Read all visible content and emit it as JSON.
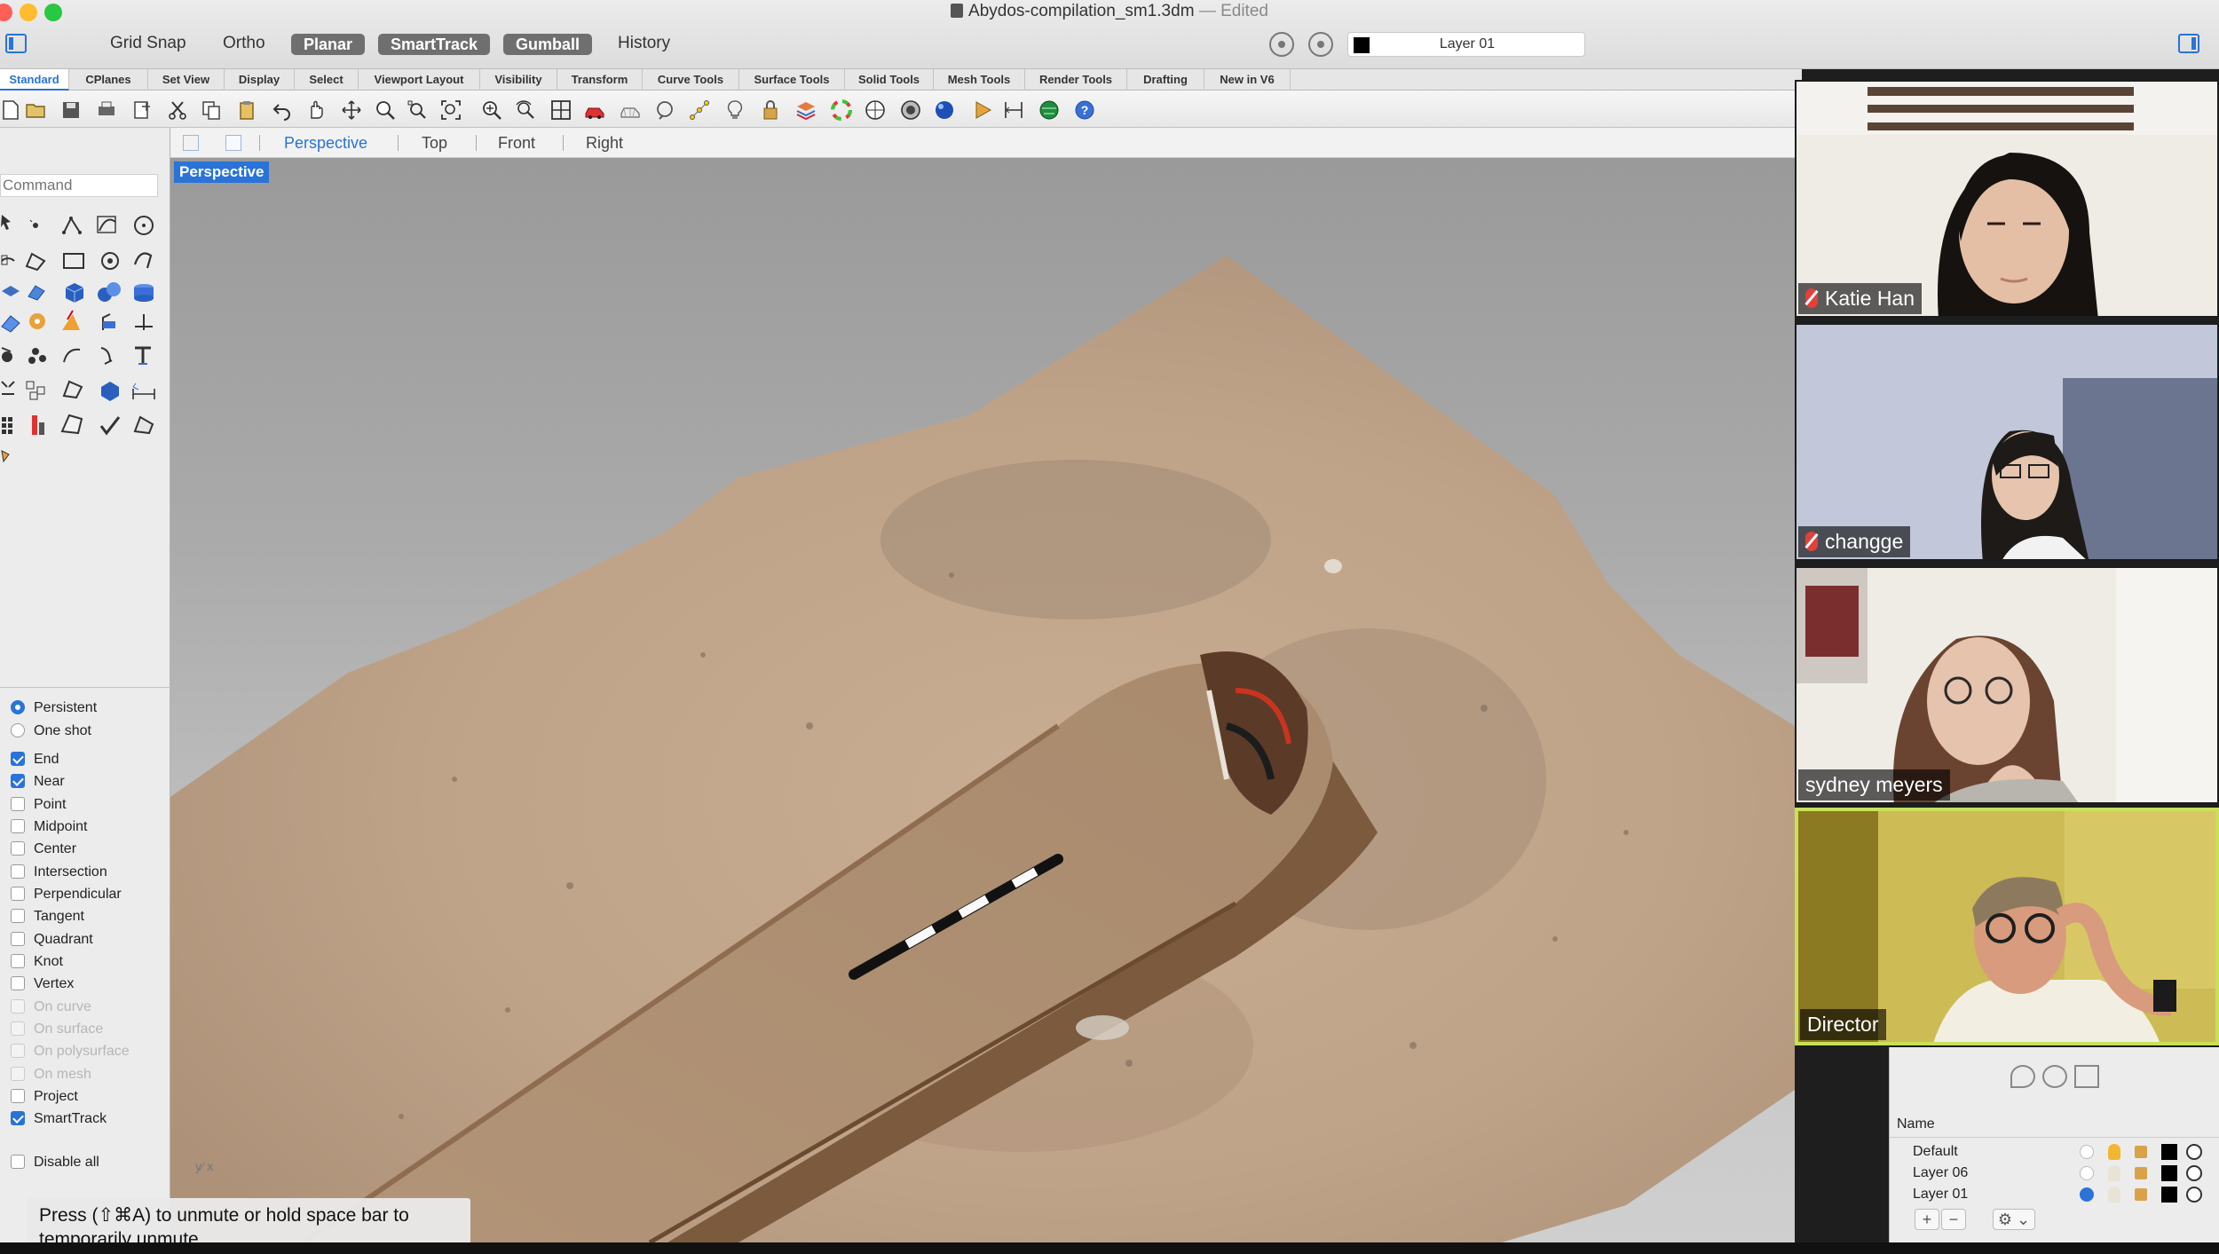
{
  "window": {
    "title": "Abydos-compilation_sm1.3dm",
    "status": "— Edited"
  },
  "toolbar_toggles": {
    "grid_snap": "Grid Snap",
    "ortho": "Ortho",
    "planar": "Planar",
    "smarttrack": "SmartTrack",
    "gumball": "Gumball",
    "history": "History"
  },
  "current_layer": "Layer 01",
  "tabs": [
    "Standard",
    "CPlanes",
    "Set View",
    "Display",
    "Select",
    "Viewport Layout",
    "Visibility",
    "Transform",
    "Curve Tools",
    "Surface Tools",
    "Solid Tools",
    "Mesh Tools",
    "Render Tools",
    "Drafting",
    "New in V6"
  ],
  "active_tab": "Standard",
  "command": {
    "placeholder": "Command"
  },
  "viewport_tabs": [
    "Perspective",
    "Top",
    "Front",
    "Right"
  ],
  "active_viewport": "Perspective",
  "viewport_label": "Perspective",
  "osnap": {
    "mode_options": [
      {
        "label": "Persistent",
        "selected": true
      },
      {
        "label": "One shot",
        "selected": false
      }
    ],
    "snaps": [
      {
        "label": "End",
        "checked": true,
        "enabled": true
      },
      {
        "label": "Near",
        "checked": true,
        "enabled": true
      },
      {
        "label": "Point",
        "checked": false,
        "enabled": true
      },
      {
        "label": "Midpoint",
        "checked": false,
        "enabled": true
      },
      {
        "label": "Center",
        "checked": false,
        "enabled": true
      },
      {
        "label": "Intersection",
        "checked": false,
        "enabled": true
      },
      {
        "label": "Perpendicular",
        "checked": false,
        "enabled": true
      },
      {
        "label": "Tangent",
        "checked": false,
        "enabled": true
      },
      {
        "label": "Quadrant",
        "checked": false,
        "enabled": true
      },
      {
        "label": "Knot",
        "checked": false,
        "enabled": true
      },
      {
        "label": "Vertex",
        "checked": false,
        "enabled": true
      },
      {
        "label": "On curve",
        "checked": false,
        "enabled": false
      },
      {
        "label": "On surface",
        "checked": false,
        "enabled": false
      },
      {
        "label": "On polysurface",
        "checked": false,
        "enabled": false
      },
      {
        "label": "On mesh",
        "checked": false,
        "enabled": false
      },
      {
        "label": "Project",
        "checked": false,
        "enabled": true
      },
      {
        "label": "SmartTrack",
        "checked": true,
        "enabled": true
      }
    ],
    "disable_all": "Disable all"
  },
  "participants": [
    {
      "name": "Katie Han",
      "muted": true,
      "speaking": false
    },
    {
      "name": "changge",
      "muted": true,
      "speaking": false
    },
    {
      "name": "sydney meyers",
      "muted": false,
      "speaking": false
    },
    {
      "name": "Director",
      "muted": false,
      "speaking": true
    }
  ],
  "layers_panel": {
    "column_header": "Name",
    "layers": [
      {
        "name": "Default",
        "current": false,
        "visible": true,
        "color": "#000000"
      },
      {
        "name": "Layer 06",
        "current": false,
        "visible": false,
        "color": "#000000"
      },
      {
        "name": "Layer 01",
        "current": true,
        "visible": false,
        "color": "#000000"
      }
    ],
    "add_label": "+",
    "remove_label": "−",
    "options_label": "⚙ ⌄"
  },
  "toast": {
    "line1": "Press  (⇧⌘A) to unmute or hold space bar to",
    "line2": "temporarily unmute."
  },
  "colors": {
    "accent": "#2a73d8",
    "active_speaker_border": "#c8e05a",
    "muted_icon": "#e0413a"
  }
}
